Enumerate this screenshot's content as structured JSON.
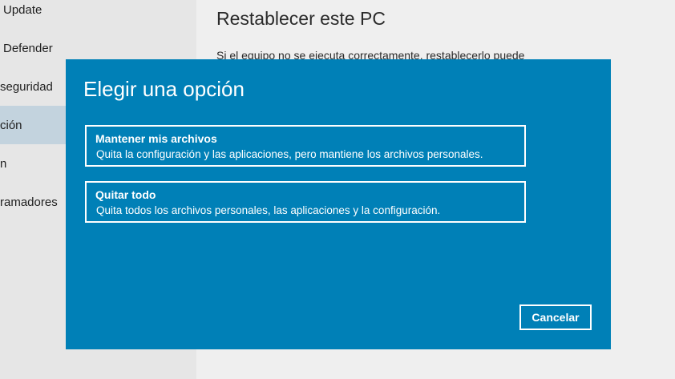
{
  "sidebar": {
    "items": [
      {
        "label": "Update"
      },
      {
        "label": "Defender"
      },
      {
        "label": "seguridad"
      },
      {
        "label": "ción",
        "selected": true
      },
      {
        "label": "n"
      },
      {
        "label": "ramadores"
      }
    ]
  },
  "main": {
    "title": "Restablecer este PC",
    "description": "Si el equipo no se ejecuta correctamente, restablecerlo puede"
  },
  "dialog": {
    "title": "Elegir una opción",
    "options": [
      {
        "title": "Mantener mis archivos",
        "description": "Quita la configuración y las aplicaciones, pero mantiene los archivos personales."
      },
      {
        "title": "Quitar todo",
        "description": "Quita todos los archivos personales, las aplicaciones y la configuración."
      }
    ],
    "cancel_label": "Cancelar"
  },
  "colors": {
    "dialog_background": "#0080b7",
    "sidebar_background": "#e6e6e6",
    "sidebar_selected": "#c3d3de"
  }
}
